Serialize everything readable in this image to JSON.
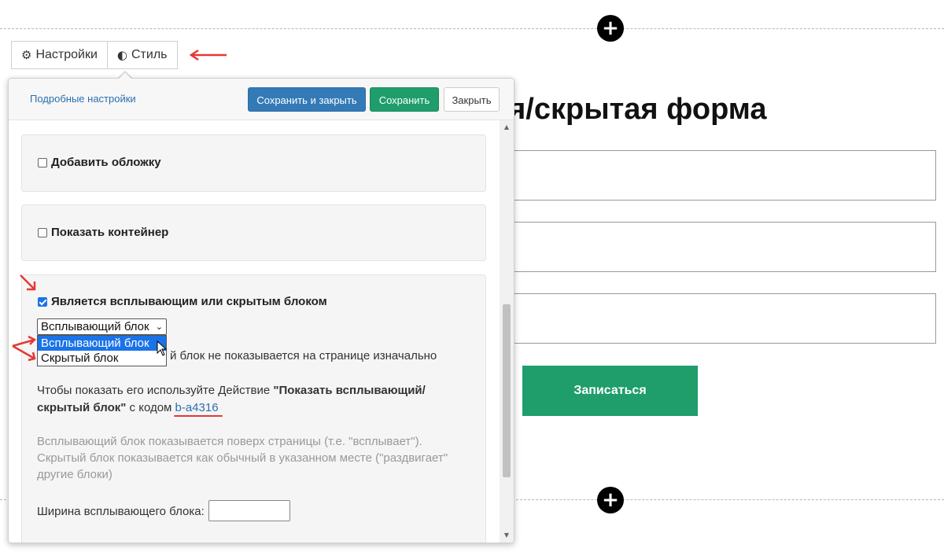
{
  "tabs": {
    "settings": {
      "label": "Настройки",
      "icon": "gear-icon"
    },
    "style": {
      "label": "Стиль",
      "icon": "contrast-icon"
    }
  },
  "panel": {
    "advanced_link": "Подробные настройки",
    "save_close": "Сохранить и закрыть",
    "save": "Сохранить",
    "close": "Закрыть"
  },
  "options": {
    "add_cover": {
      "label": "Добавить обложку",
      "checked": false
    },
    "show_container": {
      "label": "Показать контейнер",
      "checked": false
    },
    "popup_hidden": {
      "label": "Является всплывающим или скрытым блоком",
      "checked": true
    }
  },
  "block_type": {
    "selected": "Всплывающий блок",
    "options": [
      "Всплывающий блок",
      "Скрытый блок"
    ],
    "note_tail": "й блок не показывается на странице изначально"
  },
  "instructions": {
    "line1_prefix": "Чтобы показать его используйте Действие ",
    "line1_bold": "\"Показать всплывающий/",
    "line2_bold": "скрытый блок\"",
    "line2_mid": " с кодом ",
    "code": "b-a4316"
  },
  "hint": {
    "line1": "Всплывающий блок показывается поверх страницы (т.е. \"всплывает\").",
    "line2": "Скрытый блок показывается как обычный в указанном месте (\"раздвигает\"",
    "line3": "другие блоки)"
  },
  "width_field": {
    "label": "Ширина всплывающего блока:",
    "value": ""
  },
  "background": {
    "title": "ющая/скрытая форма",
    "submit": "Записаться"
  },
  "colors": {
    "primary": "#337ab7",
    "success": "#1f9d6b",
    "annotation": "#e53935"
  }
}
